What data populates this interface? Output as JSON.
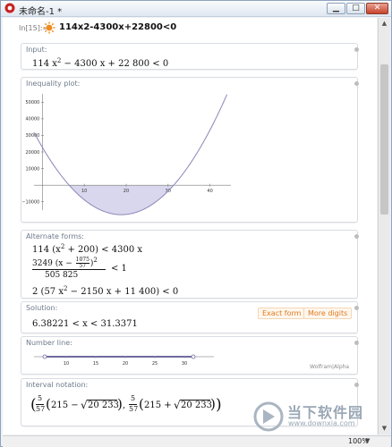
{
  "window": {
    "title": "未命名-1 *"
  },
  "input": {
    "label": "In[15]:=",
    "query": "114x2-4300x+22800<0"
  },
  "pods": {
    "input_pod": {
      "title": "Input:",
      "expr_a": "114 x",
      "expr_sup": "2",
      "expr_b": " − 4300 x + 22 800 < 0"
    },
    "plot_pod": {
      "title": "Inequality plot:"
    },
    "alternate_pod": {
      "title": "Alternate forms:",
      "line1_a": "114 (x",
      "line1_sup": "2",
      "line1_b": " + 200) < 4300 x",
      "line2_num_a": "3249 (x − ",
      "line2_frac_num": "1075",
      "line2_frac_den": "57",
      "line2_num_b": ")",
      "line2_sup": "2",
      "line2_den": "505 825",
      "line2_rhs": "< 1",
      "line3_a": "2 (57 x",
      "line3_sup": "2",
      "line3_b": " − 2150 x + 11 400) < 0"
    },
    "solution_pod": {
      "title": "Solution:",
      "expr": "6.38221 < x < 31.3371",
      "exact_btn": "Exact form",
      "more_btn": "More digits"
    },
    "numberline_pod": {
      "title": "Number line:",
      "ticks": [
        "10",
        "15",
        "20",
        "25",
        "30"
      ],
      "credit": "Wolfram|Alpha"
    },
    "interval_pod": {
      "title": "Interval notation:",
      "frac_num": "5",
      "frac_den": "57",
      "left_inner": "215 − ",
      "right_inner": "215 + ",
      "radicand": "20 233"
    }
  },
  "chart_data": {
    "type": "line",
    "title": "",
    "xlabel": "",
    "ylabel": "",
    "x_ticks": [
      10,
      20,
      30,
      40
    ],
    "y_ticks": [
      -10000,
      10000,
      20000,
      30000,
      40000,
      50000
    ],
    "y_tick_labels": [
      "−10000",
      "10000",
      "20000",
      "30000",
      "40000",
      "50000"
    ],
    "xlim": [
      -2,
      45
    ],
    "ylim": [
      -15000,
      55000
    ],
    "function": "114x^2 - 4300x + 22800",
    "shaded_interval": [
      6.38221,
      31.3371
    ],
    "colors": {
      "curve": "#8b86b6",
      "fill": "#d9d7ee"
    }
  },
  "statusbar": {
    "zoom": "100%"
  },
  "watermark": {
    "text": "当下软件园",
    "url": "www.downxia.com"
  }
}
